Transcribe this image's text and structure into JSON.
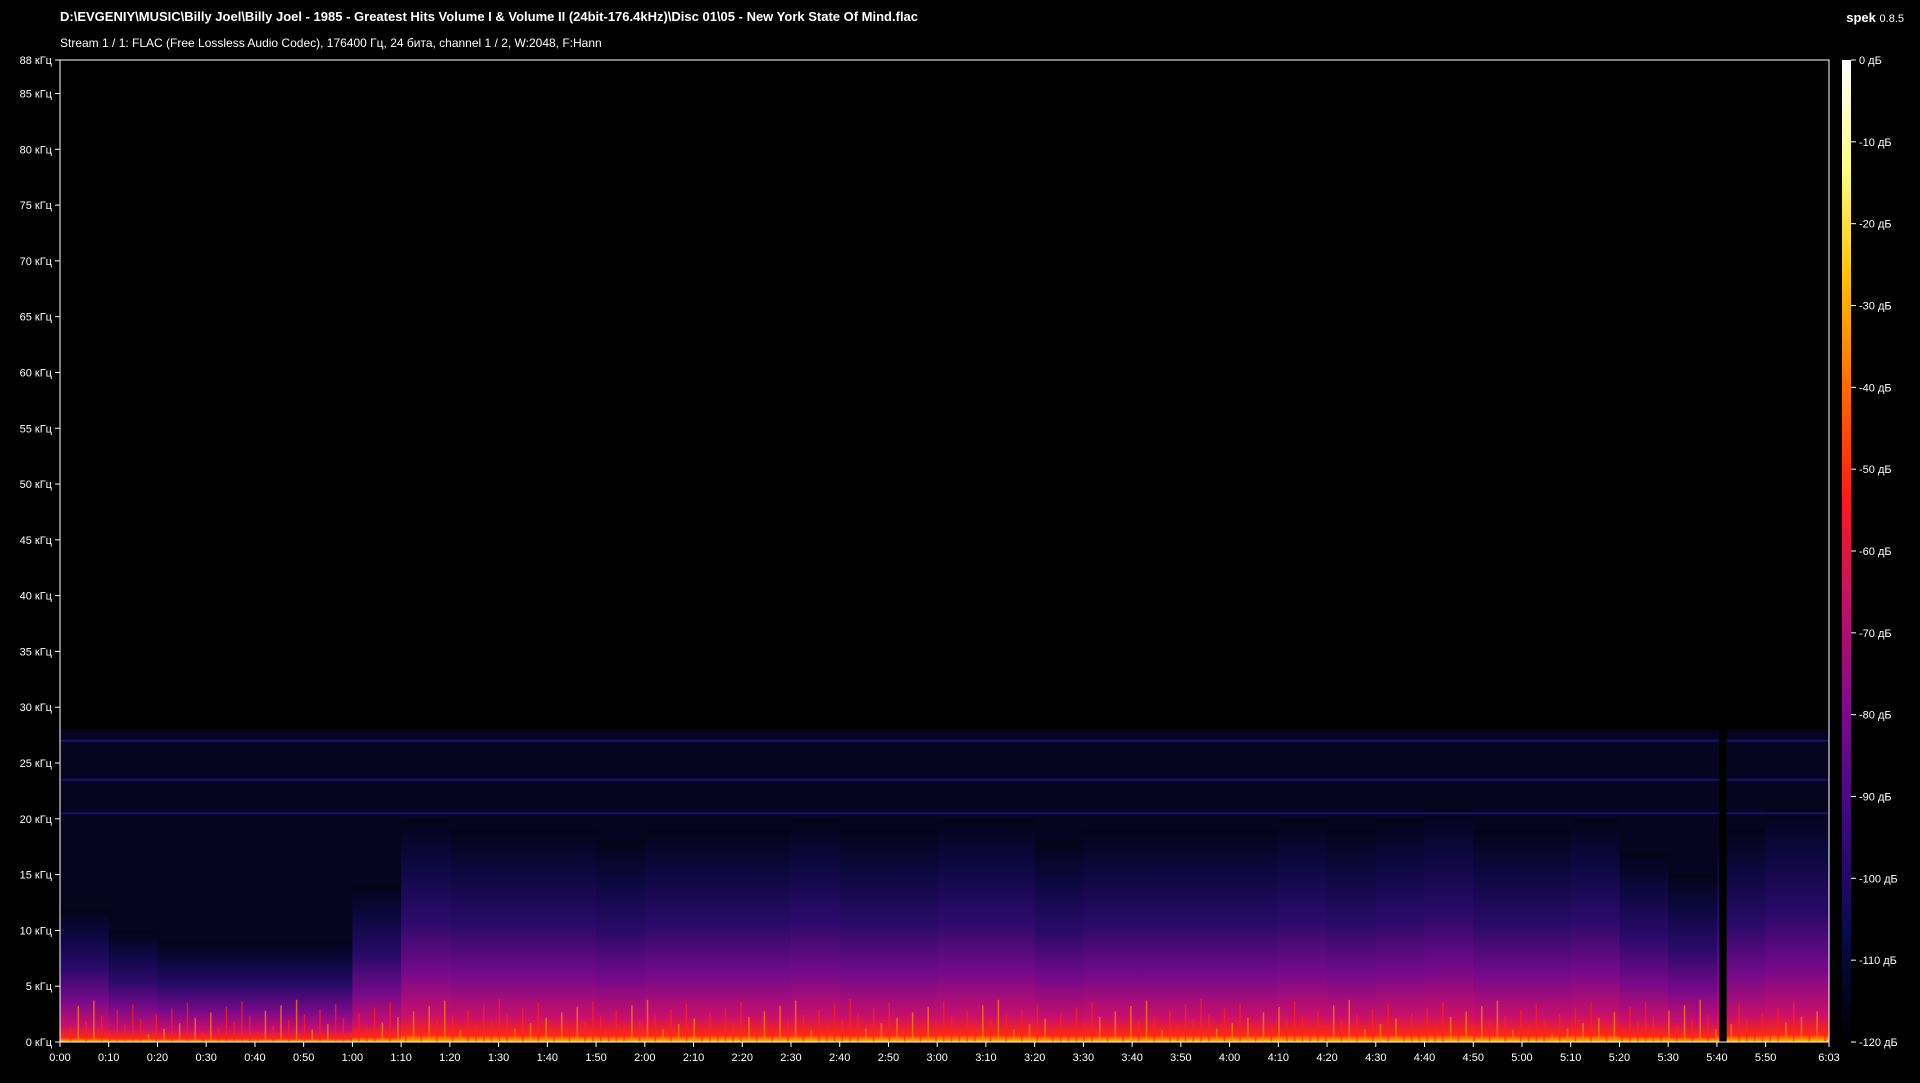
{
  "header": {
    "file_path": "D:\\EVGENIY\\MUSIC\\Billy Joel\\Billy Joel - 1985 - Greatest Hits Volume I & Volume II (24bit-176.4kHz)\\Disc 01\\05 - New York State Of Mind.flac",
    "stream_info": "Stream 1 / 1: FLAC (Free Lossless Audio Codec), 176400 Гц, 24 бита, channel 1 / 2, W:2048, F:Hann",
    "app_name": "spek",
    "app_version": "0.8.5"
  },
  "chart_data": {
    "type": "heatmap",
    "description_axes": "time vs frequency spectrogram",
    "x_ticks": [
      "0:00",
      "0:10",
      "0:20",
      "0:30",
      "0:40",
      "0:50",
      "1:00",
      "1:10",
      "1:20",
      "1:30",
      "1:40",
      "1:50",
      "2:00",
      "2:10",
      "2:20",
      "2:30",
      "2:40",
      "2:50",
      "3:00",
      "3:10",
      "3:20",
      "3:30",
      "3:40",
      "3:50",
      "4:00",
      "4:10",
      "4:20",
      "4:30",
      "4:40",
      "4:50",
      "5:00",
      "5:10",
      "5:20",
      "5:30",
      "5:40",
      "5:50",
      "6:03"
    ],
    "x_tick_seconds": [
      0,
      10,
      20,
      30,
      40,
      50,
      60,
      70,
      80,
      90,
      100,
      110,
      120,
      130,
      140,
      150,
      160,
      170,
      180,
      190,
      200,
      210,
      220,
      230,
      240,
      250,
      260,
      270,
      280,
      290,
      300,
      310,
      320,
      330,
      340,
      350,
      363
    ],
    "x_range_seconds": [
      0,
      363
    ],
    "y_ticks": [
      "0 кГц",
      "5 кГц",
      "10 кГц",
      "15 кГц",
      "20 кГц",
      "25 кГц",
      "30 кГц",
      "35 кГц",
      "40 кГц",
      "45 кГц",
      "50 кГц",
      "55 кГц",
      "60 кГц",
      "65 кГц",
      "70 кГц",
      "75 кГц",
      "80 кГц",
      "85 кГц",
      "88 кГц"
    ],
    "y_tick_khz": [
      0,
      5,
      10,
      15,
      20,
      25,
      30,
      35,
      40,
      45,
      50,
      55,
      60,
      65,
      70,
      75,
      80,
      85,
      88
    ],
    "y_range_khz": [
      0,
      88
    ],
    "colorbar_ticks": [
      "0 дБ",
      "-10 дБ",
      "-20 дБ",
      "-30 дБ",
      "-40 дБ",
      "-50 дБ",
      "-60 дБ",
      "-70 дБ",
      "-80 дБ",
      "-90 дБ",
      "-100 дБ",
      "-110 дБ",
      "-120 дБ"
    ],
    "colorbar_range_db": [
      -120,
      0
    ],
    "colormap": [
      "#000000",
      "#0a0a4a",
      "#3a0a7a",
      "#7a0a8a",
      "#c0106a",
      "#ff1a1a",
      "#ff6a00",
      "#ffc000",
      "#ffff80",
      "#ffffff"
    ],
    "energy_ceiling_khz": 28,
    "line_components_khz": [
      27,
      23.5,
      20.5
    ],
    "quiet_gap_seconds": [
      340.5,
      342
    ],
    "band_edge_khz_per_10s": [
      12,
      10,
      9,
      9,
      9,
      9,
      14,
      20,
      19,
      19,
      19,
      18,
      19,
      19,
      19,
      20,
      19,
      19,
      20,
      20,
      18,
      19,
      19,
      19,
      19,
      20,
      19,
      20,
      21,
      19,
      19,
      20,
      17,
      15,
      19,
      21,
      22
    ]
  }
}
